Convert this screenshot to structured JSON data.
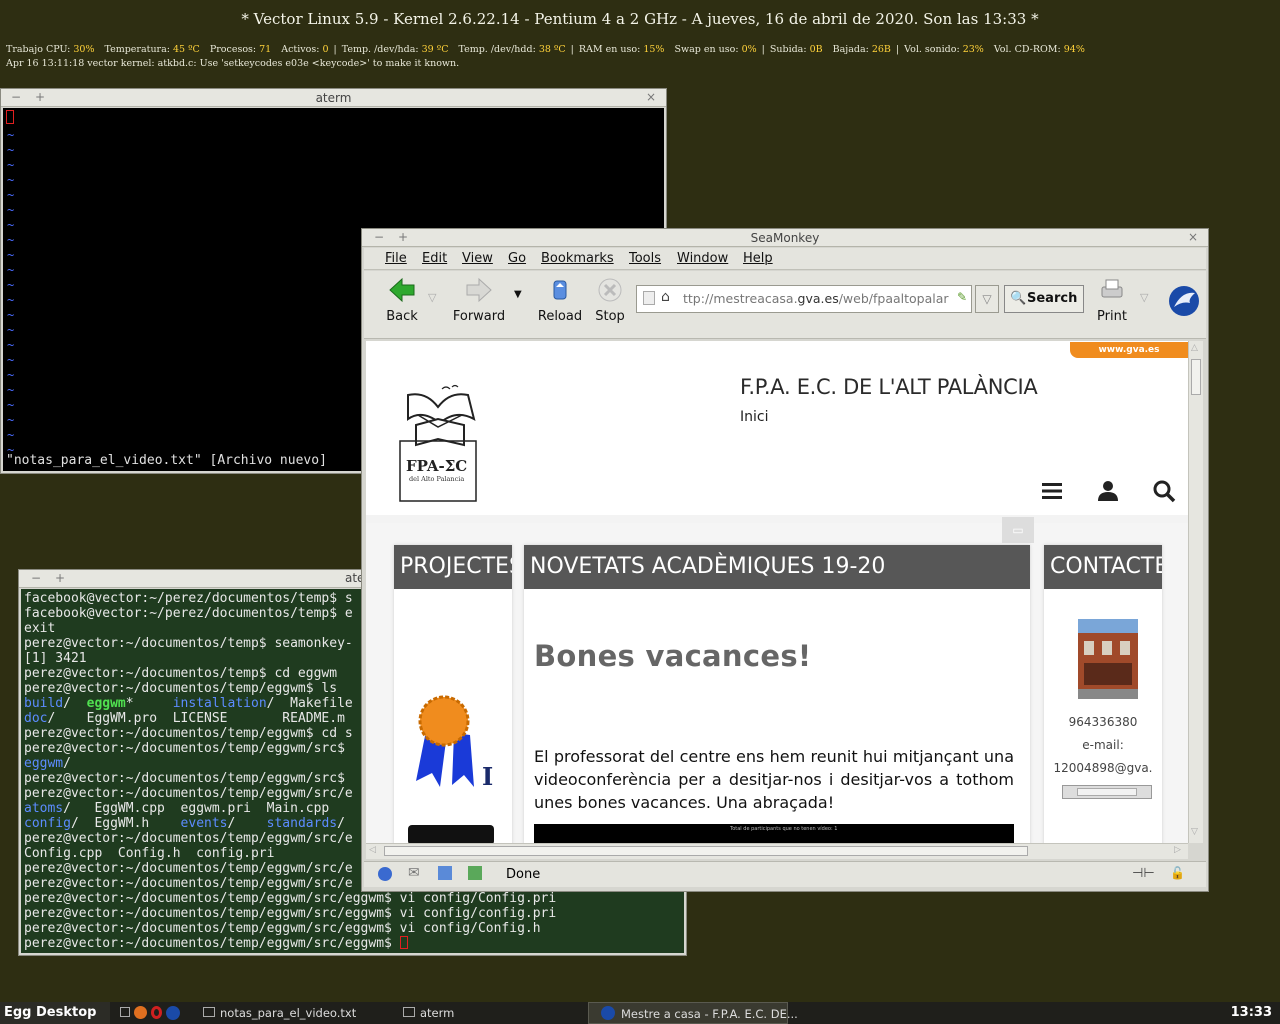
{
  "desktop": {
    "title": "*  Vector Linux 5.9 - Kernel 2.6.22.14 - Pentium 4 a 2 GHz     -     A jueves, 16 de abril de 2020. Son las 13:33  *",
    "stats": [
      {
        "label": "Trabajo CPU:",
        "value": "30%"
      },
      {
        "label": "Temperatura:",
        "value": "45 ºC"
      },
      {
        "label": "Procesos:",
        "value": "71"
      },
      {
        "label": "Activos:",
        "value": "0",
        "sep_after": true
      },
      {
        "label": "Temp. /dev/hda:",
        "value": "39 ºC"
      },
      {
        "label": "Temp. /dev/hdd:",
        "value": "38 ºC",
        "sep_after": true
      },
      {
        "label": "RAM en uso:",
        "value": "15%"
      },
      {
        "label": "Swap en uso:",
        "value": "0%",
        "sep_after": true
      },
      {
        "label": "Subida:",
        "value": "0B"
      },
      {
        "label": "Bajada:",
        "value": "26B",
        "sep_after": true
      },
      {
        "label": "Vol. sonido:",
        "value": "23%"
      },
      {
        "label": "Vol. CD-ROM:",
        "value": "94%"
      }
    ],
    "log_line": "Apr 16 13:11:18 vector kernel: atkbd.c: Use 'setkeycodes e03e <keycode>' to make it known."
  },
  "vim_window": {
    "title": "aterm",
    "minimize": "−",
    "maximize": "+",
    "close": "×",
    "tilde": "~",
    "status_line": "\"notas_para_el_video.txt\" [Archivo nuevo]"
  },
  "term_window": {
    "title": "aterm",
    "minimize": "−",
    "maximize": "+",
    "lines": [
      [
        {
          "t": "facebook@vector:~/perez/documentos/temp$ s"
        }
      ],
      [
        {
          "t": "facebook@vector:~/perez/documentos/temp$ e"
        }
      ],
      [
        {
          "t": "exit"
        }
      ],
      [
        {
          "t": "perez@vector:~/documentos/temp$ seamonkey-"
        }
      ],
      [
        {
          "t": "[1] 3421"
        }
      ],
      [
        {
          "t": "perez@vector:~/documentos/temp$ cd eggwm"
        }
      ],
      [
        {
          "t": "perez@vector:~/documentos/temp/eggwm$ ls"
        }
      ],
      [
        {
          "t": "build",
          "c": "c-blue"
        },
        {
          "t": "/  "
        },
        {
          "t": "eggwm",
          "c": "c-green"
        },
        {
          "t": "*     "
        },
        {
          "t": "installation",
          "c": "c-blue"
        },
        {
          "t": "/  Makefile"
        }
      ],
      [
        {
          "t": "doc",
          "c": "c-blue"
        },
        {
          "t": "/    EggWM.pro  LICENSE       README.m"
        }
      ],
      [
        {
          "t": "perez@vector:~/documentos/temp/eggwm$ cd s"
        }
      ],
      [
        {
          "t": "perez@vector:~/documentos/temp/eggwm/src$"
        }
      ],
      [
        {
          "t": "eggwm",
          "c": "c-blue"
        },
        {
          "t": "/"
        }
      ],
      [
        {
          "t": "perez@vector:~/documentos/temp/eggwm/src$"
        }
      ],
      [
        {
          "t": "perez@vector:~/documentos/temp/eggwm/src/e"
        }
      ],
      [
        {
          "t": "atoms",
          "c": "c-blue"
        },
        {
          "t": "/   EggWM.cpp  eggwm.pri  Main.cpp"
        }
      ],
      [
        {
          "t": "config",
          "c": "c-blue"
        },
        {
          "t": "/  EggWM.h    "
        },
        {
          "t": "events",
          "c": "c-blue"
        },
        {
          "t": "/    "
        },
        {
          "t": "standards",
          "c": "c-blue"
        },
        {
          "t": "/"
        }
      ],
      [
        {
          "t": "perez@vector:~/documentos/temp/eggwm/src/e"
        }
      ],
      [
        {
          "t": "Config.cpp  Config.h  config.pri"
        }
      ],
      [
        {
          "t": "perez@vector:~/documentos/temp/eggwm/src/e"
        }
      ],
      [
        {
          "t": "perez@vector:~/documentos/temp/eggwm/src/e"
        }
      ],
      [
        {
          "t": "perez@vector:~/documentos/temp/eggwm/src/eggwm$ vi config/Config.pri"
        }
      ],
      [
        {
          "t": "perez@vector:~/documentos/temp/eggwm/src/eggwm$ vi config/config.pri"
        }
      ],
      [
        {
          "t": "perez@vector:~/documentos/temp/eggwm/src/eggwm$ vi config/Config.h"
        }
      ],
      [
        {
          "t": "perez@vector:~/documentos/temp/eggwm/src/eggwm$ "
        }
      ]
    ]
  },
  "browser": {
    "title": "SeaMonkey",
    "minimize": "−",
    "maximize": "+",
    "close": "×",
    "menu": [
      "File",
      "Edit",
      "View",
      "Go",
      "Bookmarks",
      "Tools",
      "Window",
      "Help"
    ],
    "nav": {
      "back": "Back",
      "forward": "Forward",
      "reload": "Reload",
      "stop": "Stop",
      "search": "Search",
      "print": "Print"
    },
    "url_prefix": "ttp://mestreacasa.",
    "url_domain": "gva.es",
    "url_suffix": "/web/fpaaltopalar",
    "status": "Done",
    "colors": {
      "back_arrow": "#2ea82e",
      "gva_orange": "#f08c1e",
      "header_gray": "#575757"
    }
  },
  "site": {
    "gva_tab": "www.gva.es",
    "title": "F.P.A. E.C. DE L'ALT PALÀNCIA",
    "subtitle": "Inici",
    "logo_text": "FPA-ΣC",
    "logo_sub": "del Alto Palancia",
    "col_left_head": "PROJECTES",
    "col_mid_head": "NOVETATS ACADÈMIQUES 19-20",
    "col_right_head": "CONTACTE",
    "post_title": "Bones vacances!",
    "post_body": "El professorat del centre ens hem reunit hui mitjançant una videoconferència per a desitjar-nos i desitjar-vos a tothom unes bones vacances. Una abraçada!",
    "video_caption": "Total de participants que no tenen vídeo: 1",
    "phone": "964336380",
    "email_label": "e-mail:",
    "email": "12004898@gva."
  },
  "taskbar": {
    "start": "Egg Desktop",
    "tasks": [
      "notas_para_el_video.txt",
      "aterm",
      "Mestre a casa - F.P.A. E.C. DE..."
    ],
    "clock": "13:33"
  }
}
